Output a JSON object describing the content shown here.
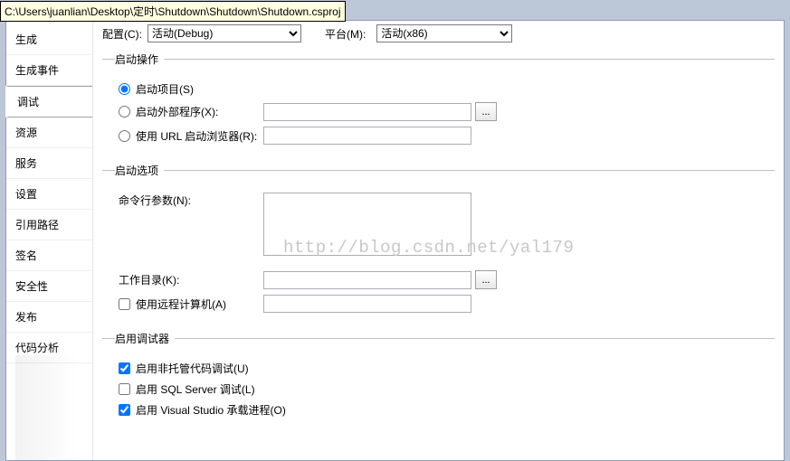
{
  "tooltip": "C:\\Users\\juanlian\\Desktop\\定时\\Shutdown\\Shutdown\\Shutdown.csproj",
  "sidebar": {
    "items": [
      {
        "label": "生成"
      },
      {
        "label": "生成事件"
      },
      {
        "label": "调试"
      },
      {
        "label": "资源"
      },
      {
        "label": "服务"
      },
      {
        "label": "设置"
      },
      {
        "label": "引用路径"
      },
      {
        "label": "签名"
      },
      {
        "label": "安全性"
      },
      {
        "label": "发布"
      },
      {
        "label": "代码分析"
      }
    ]
  },
  "top": {
    "config_label": "配置(C):",
    "config_value": "活动(Debug)",
    "platform_label": "平台(M):",
    "platform_value": "活动(x86)"
  },
  "start_action": {
    "legend": "启动操作",
    "start_project": "启动项目(S)",
    "start_external": "启动外部程序(X):",
    "start_url": "使用 URL 启动浏览器(R):",
    "external_value": "",
    "url_value": "",
    "browse": "..."
  },
  "start_options": {
    "legend": "启动选项",
    "cmd_args_label": "命令行参数(N):",
    "cmd_args_value": "",
    "work_dir_label": "工作目录(K):",
    "work_dir_value": "",
    "remote_label": "使用远程计算机(A)",
    "remote_value": "",
    "browse": "..."
  },
  "debuggers": {
    "legend": "启用调试器",
    "unmanaged": "启用非托管代码调试(U)",
    "sql": "启用 SQL Server 调试(L)",
    "vshost": "启用 Visual Studio 承载进程(O)"
  },
  "watermark": "http://blog.csdn.net/yal179"
}
